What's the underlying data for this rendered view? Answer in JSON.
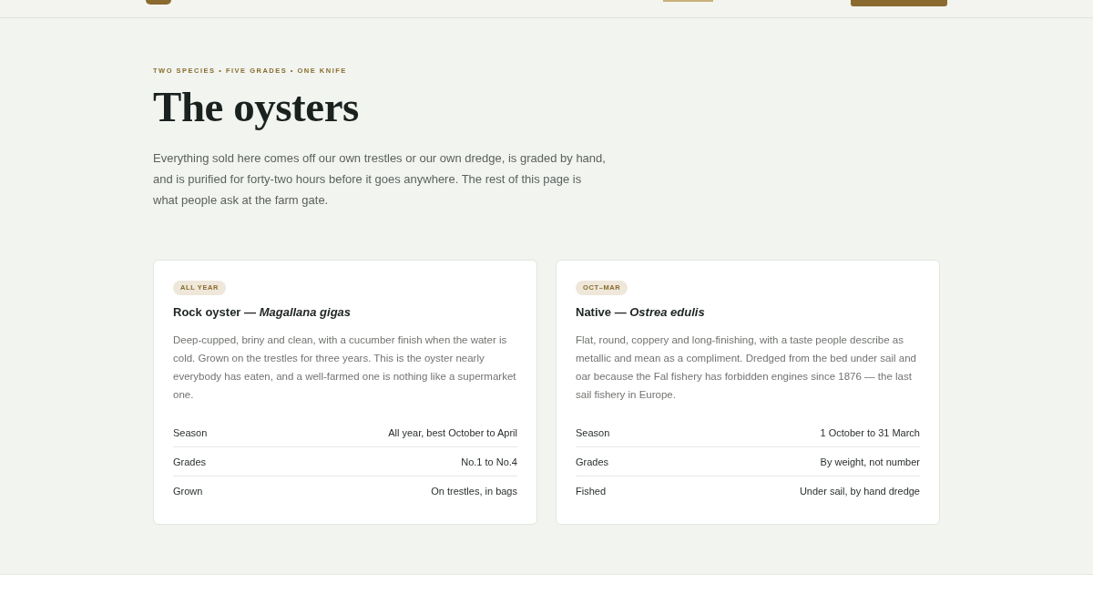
{
  "intro": {
    "eyebrow": "TWO SPECIES • FIVE GRADES • ONE KNIFE",
    "title": "The oysters",
    "text": "Everything sold here comes off our own trestles or our own dredge, is graded by hand, and is purified for forty-two hours before it goes anywhere. The rest of this page is what people ask at the farm gate."
  },
  "cards": [
    {
      "badge": "ALL YEAR",
      "title": "Rock oyster — *Magallana gigas*",
      "description": "Deep-cupped, briny and clean, with a cucumber finish when the water is cold. Grown on the trestles for three years. This is the oyster nearly everybody has eaten, and a well-farmed one is nothing like a supermarket one.",
      "specs": [
        {
          "label": "Season",
          "value": "All year, best October to April"
        },
        {
          "label": "Grades",
          "value": "No.1 to No.4"
        },
        {
          "label": "Grown",
          "value": "On trestles, in bags"
        }
      ]
    },
    {
      "badge": "OCT–MAR",
      "title": "Native — *Ostrea edulis*",
      "description": "Flat, round, coppery and long-finishing, with a taste people describe as metallic and mean as a compliment. Dredged from the bed under sail and oar because the Fal fishery has forbidden engines since 1876 — the last sail fishery in Europe.",
      "specs": [
        {
          "label": "Season",
          "value": "1 October to 31 March"
        },
        {
          "label": "Grades",
          "value": "By weight, not number"
        },
        {
          "label": "Fished",
          "value": "Under sail, by hand dredge"
        }
      ]
    }
  ]
}
